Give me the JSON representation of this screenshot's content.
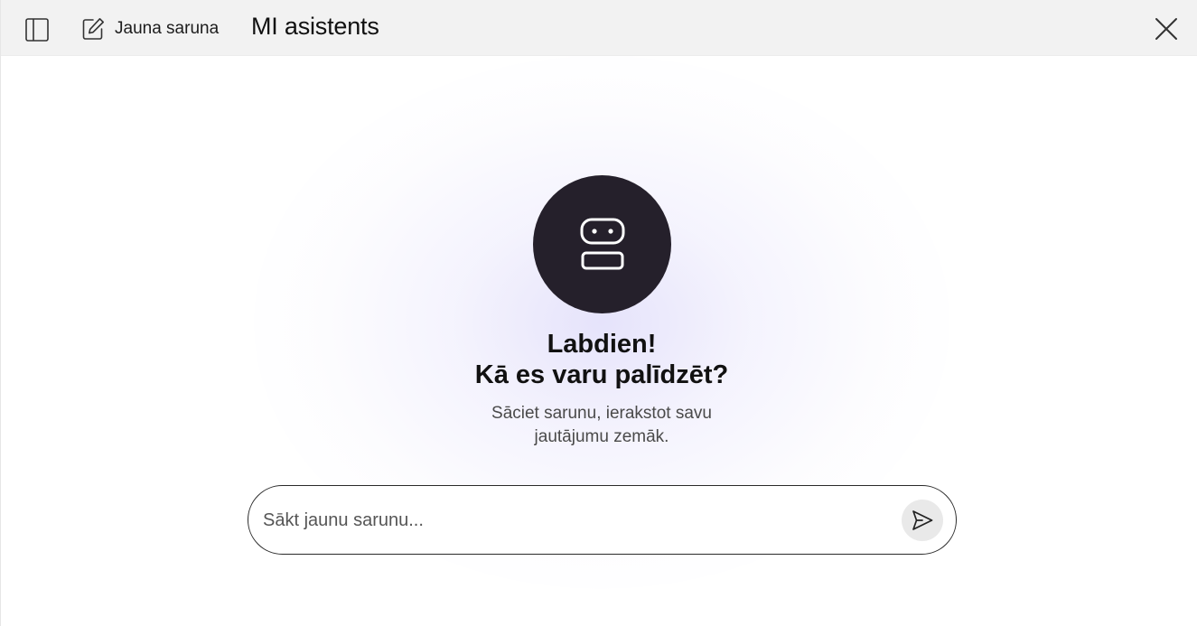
{
  "header": {
    "sidebar_toggle_icon": "sidebar-panel-icon",
    "new_chat_icon": "edit-square-icon",
    "new_chat_label": "Jauna saruna",
    "title": "MI asistents",
    "close_icon": "close-icon"
  },
  "welcome": {
    "avatar_icon": "robot-icon",
    "greeting_line1": "Labdien!",
    "greeting_line2": "Kā es varu palīdzēt?",
    "subtext_line1": "Sāciet sarunu, ierakstot savu",
    "subtext_line2": "jautājumu zemāk."
  },
  "composer": {
    "value": "",
    "placeholder": "Sākt jaunu sarunu...",
    "send_icon": "send-icon"
  },
  "colors": {
    "header_bg": "#f2f2f2",
    "avatar_bg": "#25202b",
    "glow": "#e1defa",
    "send_bg": "#e9e9e9"
  }
}
